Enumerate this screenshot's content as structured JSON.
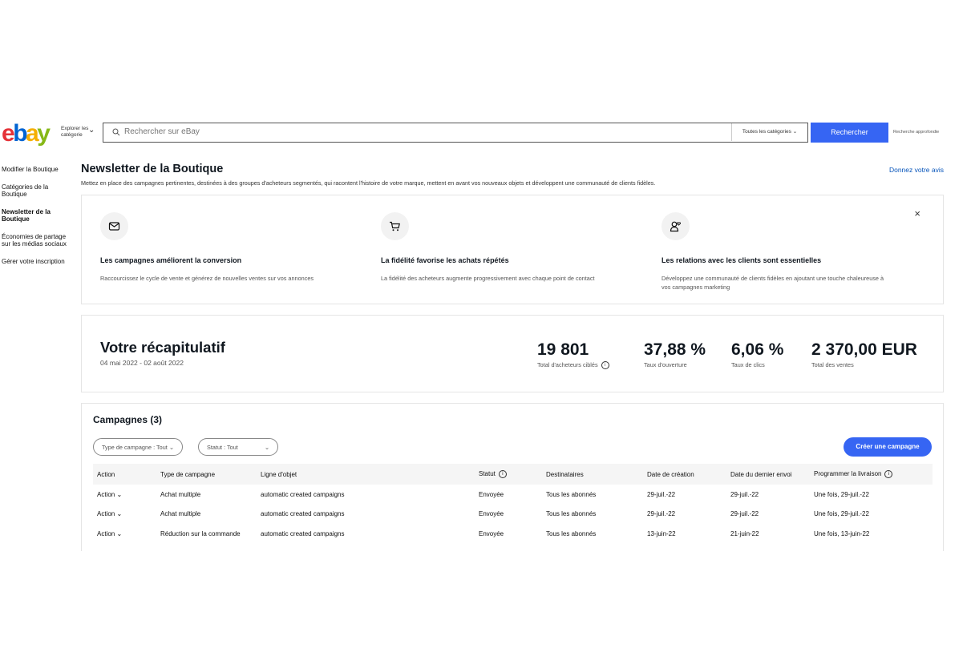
{
  "header": {
    "logo_letters": [
      "e",
      "b",
      "a",
      "y"
    ],
    "explore_label": "Explorer les catégorie",
    "search_placeholder": "Rechercher sur eBay",
    "category_select": "Toutes les catégories",
    "search_button": "Rechercher",
    "advanced_search": "Recherche approfondie"
  },
  "sidebar": {
    "items": [
      {
        "label": "Modifier la Boutique"
      },
      {
        "label": "Catégories de la Boutique"
      },
      {
        "label": "Newsletter de la Boutique"
      },
      {
        "label": "Économies de partage sur les médias sociaux"
      },
      {
        "label": "Gérer votre inscription"
      }
    ],
    "active_index": 2
  },
  "page": {
    "title": "Newsletter de la Boutique",
    "subtitle": "Mettez en place des campagnes pertinentes, destinées à des groupes d'acheteurs segmentés, qui racontent l'histoire de votre marque, mettent en avant vos nouveaux objets et développent une communauté de clients fidèles.",
    "feedback_link": "Donnez votre avis"
  },
  "info_card": {
    "close": "×",
    "benefits": [
      {
        "icon": "mail-icon",
        "title": "Les campagnes améliorent la conversion",
        "desc": "Raccourcissez le cycle de vente et générez de nouvelles ventes sur vos annonces"
      },
      {
        "icon": "cart-icon",
        "title": "La fidélité favorise les achats répétés",
        "desc": "La fidélité des acheteurs augmente progressivement avec chaque point de contact"
      },
      {
        "icon": "person-heart-icon",
        "title": "Les relations avec les clients sont essentielles",
        "desc": "Développez une communauté de clients fidèles en ajoutant une touche chaleureuse à vos campagnes marketing"
      }
    ]
  },
  "summary": {
    "title": "Votre récapitulatif",
    "date_range": "04 mai 2022 - 02 août 2022",
    "metrics": [
      {
        "value": "19 801",
        "label": "Total d'acheteurs ciblés"
      },
      {
        "value": "37,88 %",
        "label": "Taux d'ouverture"
      },
      {
        "value": "6,06 %",
        "label": "Taux de clics"
      },
      {
        "value": "2 370,00 EUR",
        "label": "Total des ventes"
      }
    ]
  },
  "campaigns": {
    "title": "Campagnes (3)",
    "filters": [
      "Type de campagne : Tout",
      "Statut : Tout"
    ],
    "create_button": "Créer une campagne",
    "columns": [
      "Action",
      "Type de campagne",
      "Ligne d'objet",
      "Statut",
      "Destinataires",
      "Date de création",
      "Date du dernier envoi",
      "Programmer la livraison"
    ],
    "rows": [
      [
        "Action",
        "Achat multiple",
        "automatic created campaigns",
        "Envoyée",
        "Tous les abonnés",
        "29-juil.-22",
        "29-juil.-22",
        "Une fois, 29-juil.-22"
      ],
      [
        "Action",
        "Achat multiple",
        "automatic created campaigns",
        "Envoyée",
        "Tous les abonnés",
        "29-juil.-22",
        "29-juil.-22",
        "Une fois, 29-juil.-22"
      ],
      [
        "Action",
        "Réduction sur la commande",
        "automatic created campaigns",
        "Envoyée",
        "Tous les abonnés",
        "13-juin-22",
        "21-juin-22",
        "Une fois, 13-juin-22"
      ]
    ]
  },
  "colors": {
    "primary": "#3665f3",
    "link": "#0654ba",
    "logo_e": "#e53238",
    "logo_b": "#0064d2",
    "logo_a": "#f5af02",
    "logo_y": "#86b817"
  }
}
